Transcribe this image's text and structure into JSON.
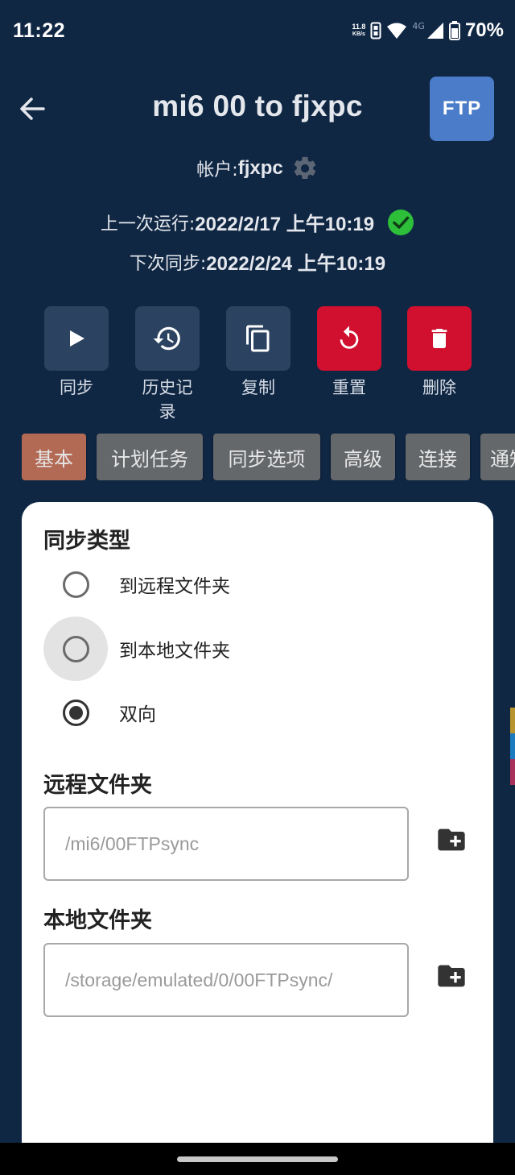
{
  "status_bar": {
    "time": "11:22",
    "net_speed_value": "11.8",
    "net_speed_unit": "KB/s",
    "network_type": "4G",
    "battery": "70%"
  },
  "header": {
    "title": "mi6 00 to fjxpc",
    "badge": "FTP"
  },
  "info": {
    "account_label": "帐户: ",
    "account_value": "fjxpc",
    "last_run_label": "上一次运行: ",
    "last_run_value": "2022/2/17 上午10:19",
    "next_sync_label": "下次同步: ",
    "next_sync_value": "2022/2/24 上午10:19"
  },
  "actions": [
    {
      "label": "同步",
      "icon": "play-icon"
    },
    {
      "label": "历史记录",
      "icon": "history-icon"
    },
    {
      "label": "复制",
      "icon": "copy-icon"
    },
    {
      "label": "重置",
      "icon": "reset-icon"
    },
    {
      "label": "删除",
      "icon": "trash-icon"
    }
  ],
  "tabs": [
    "基本",
    "计划任务",
    "同步选项",
    "高级",
    "连接",
    "通知"
  ],
  "sync_type": {
    "title": "同步类型",
    "options": [
      "到远程文件夹",
      "到本地文件夹",
      "双向"
    ],
    "selected": "双向"
  },
  "remote_folder": {
    "title": "远程文件夹",
    "path": "/mi6/00FTPsync"
  },
  "local_folder": {
    "title": "本地文件夹",
    "path": "/storage/emulated/0/00FTPsync/"
  },
  "colors": {
    "background": "#102744",
    "action_button": "#2b4360",
    "danger": "#d0102e",
    "active_tab": "#b36a55",
    "tab": "#65686b",
    "ftp_badge": "#4a7cc9",
    "success": "#2dbe3a"
  }
}
